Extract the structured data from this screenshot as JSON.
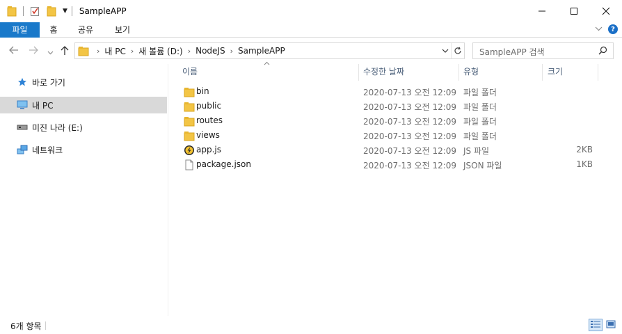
{
  "window": {
    "title": "SampleAPP",
    "controls": {
      "minimize": "—",
      "maximize": "☐",
      "close": "✕"
    }
  },
  "ribbon": {
    "tabs": [
      {
        "label": "파일",
        "active": true
      },
      {
        "label": "홈"
      },
      {
        "label": "공유"
      },
      {
        "label": "보기"
      }
    ],
    "help_label": "?"
  },
  "address": {
    "path": [
      "내 PC",
      "새 볼륨 (D:)",
      "NodeJS",
      "SampleAPP"
    ]
  },
  "search": {
    "placeholder": "SampleAPP 검색"
  },
  "navpane": {
    "items": [
      {
        "label": "바로 가기",
        "icon": "star-icon"
      },
      {
        "label": "내 PC",
        "icon": "computer-icon",
        "selected": true
      },
      {
        "label": "미진 나라 (E:)",
        "icon": "drive-icon"
      },
      {
        "label": "네트워크",
        "icon": "network-icon"
      }
    ]
  },
  "columns": {
    "name": "이름",
    "date": "수정한 날짜",
    "type": "유형",
    "size": "크기"
  },
  "files": [
    {
      "name": "bin",
      "date": "2020-07-13 오전 12:09",
      "type": "파일 폴더",
      "size": "",
      "icon": "folder-icon"
    },
    {
      "name": "public",
      "date": "2020-07-13 오전 12:09",
      "type": "파일 폴더",
      "size": "",
      "icon": "folder-icon"
    },
    {
      "name": "routes",
      "date": "2020-07-13 오전 12:09",
      "type": "파일 폴더",
      "size": "",
      "icon": "folder-icon"
    },
    {
      "name": "views",
      "date": "2020-07-13 오전 12:09",
      "type": "파일 폴더",
      "size": "",
      "icon": "folder-icon"
    },
    {
      "name": "app.js",
      "date": "2020-07-13 오전 12:09",
      "type": "JS 파일",
      "size": "2KB",
      "icon": "js-file-icon"
    },
    {
      "name": "package.json",
      "date": "2020-07-13 오전 12:09",
      "type": "JSON 파일",
      "size": "1KB",
      "icon": "file-icon"
    }
  ],
  "status": {
    "count": "6개 항목"
  },
  "colors": {
    "accent": "#1979ca",
    "folder": "#f3c545",
    "selected": "#d9d9d9"
  }
}
